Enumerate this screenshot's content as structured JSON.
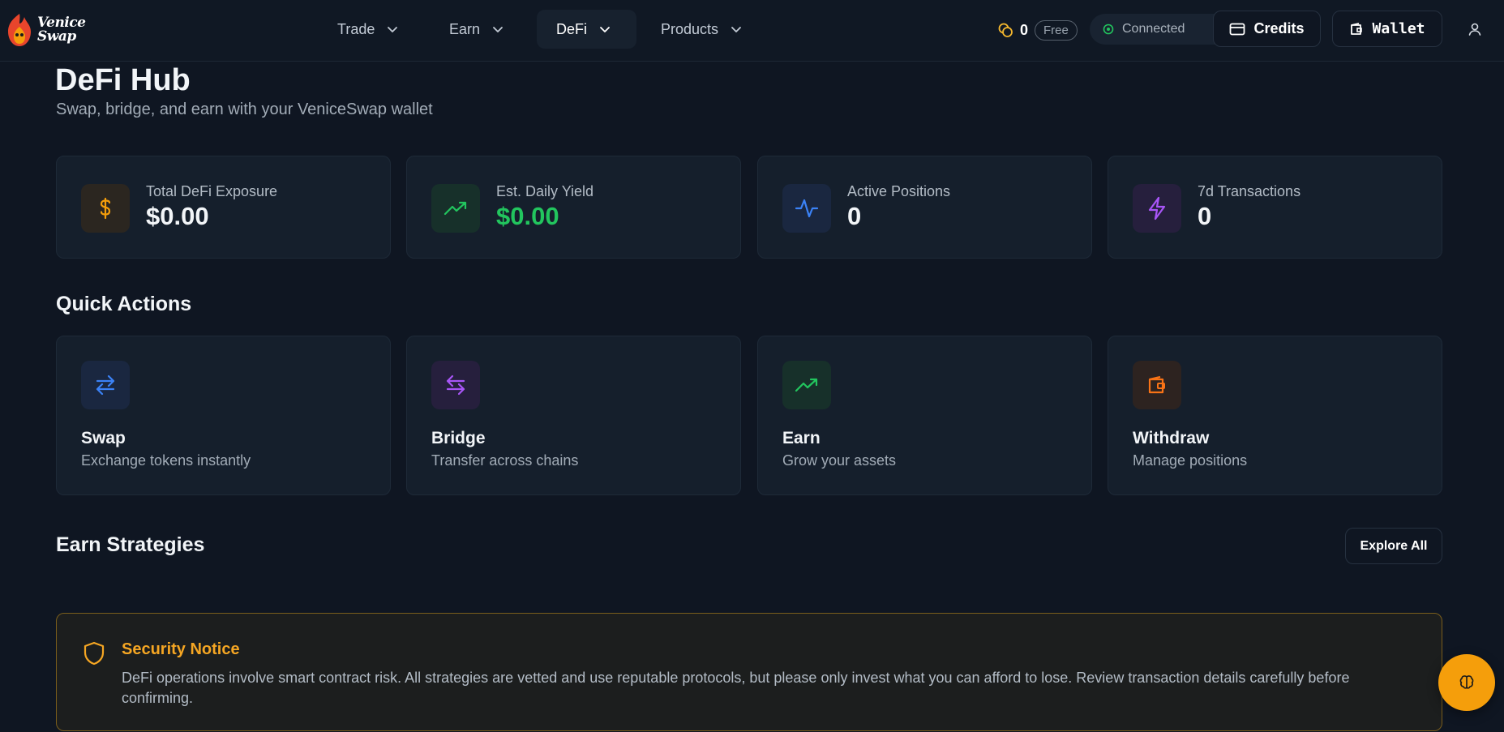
{
  "brand": {
    "name_line1": "Venice",
    "name_line2": "Swap"
  },
  "nav": {
    "items": [
      {
        "label": "Trade",
        "icon": "chevron-down-icon"
      },
      {
        "label": "Earn",
        "icon": "chevron-down-icon"
      },
      {
        "label": "DeFi",
        "icon": "chevron-down-icon",
        "active": true
      },
      {
        "label": "Products",
        "icon": "chevron-down-icon"
      }
    ]
  },
  "header": {
    "credit_count": "0",
    "plan_badge": "Free",
    "status": "Connected",
    "credits_label": "Credits",
    "wallet_label": "Wallet"
  },
  "page": {
    "title": "DeFi Hub",
    "subtitle": "Swap, bridge, and earn with your VeniceSwap wallet"
  },
  "stats": [
    {
      "label": "Total DeFi Exposure",
      "value": "$0.00",
      "icon": "dollar-icon",
      "color": "#f59e0b"
    },
    {
      "label": "Est. Daily Yield",
      "value": "$0.00",
      "icon": "trending-up-icon",
      "color": "#22c55e"
    },
    {
      "label": "Active Positions",
      "value": "0",
      "icon": "activity-icon",
      "color": "#3b82f6"
    },
    {
      "label": "7d Transactions",
      "value": "0",
      "icon": "zap-icon",
      "color": "#a855f7"
    }
  ],
  "quick_actions": {
    "title": "Quick Actions",
    "items": [
      {
        "title": "Swap",
        "desc": "Exchange tokens instantly",
        "icon": "swap-arrows-icon",
        "color": "#3b82f6"
      },
      {
        "title": "Bridge",
        "desc": "Transfer across chains",
        "icon": "bridge-arrows-icon",
        "color": "#a855f7"
      },
      {
        "title": "Earn",
        "desc": "Grow your assets",
        "icon": "trending-up-icon",
        "color": "#22c55e"
      },
      {
        "title": "Withdraw",
        "desc": "Manage positions",
        "icon": "wallet-icon",
        "color": "#f97316"
      }
    ]
  },
  "earn_strategies": {
    "title": "Earn Strategies",
    "explore_label": "Explore All"
  },
  "notice": {
    "title": "Security Notice",
    "text": "DeFi operations involve smart contract risk. All strategies are vetted and use reputable protocols, but please only invest what you can afford to lose. Review transaction details carefully before confirming."
  }
}
